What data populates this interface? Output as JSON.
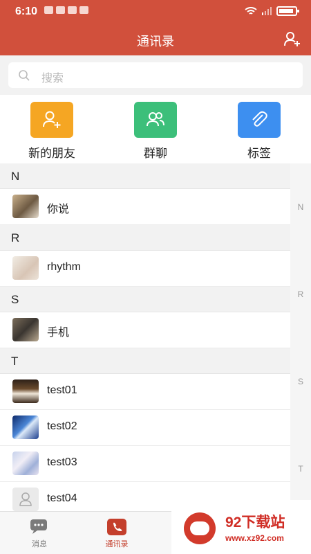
{
  "status_bar": {
    "time": "6:10"
  },
  "header": {
    "title": "通讯录",
    "add_icon": "add-contact-icon"
  },
  "search": {
    "placeholder": "搜索"
  },
  "quick_actions": [
    {
      "label": "新的朋友",
      "icon": "add-user-icon",
      "color": "#f5a623"
    },
    {
      "label": "群聊",
      "icon": "group-icon",
      "color": "#3cbf7a"
    },
    {
      "label": "标签",
      "icon": "paperclip-icon",
      "color": "#3d8ff0"
    }
  ],
  "sections": [
    {
      "letter": "N",
      "contacts": [
        {
          "name": "你说"
        }
      ]
    },
    {
      "letter": "R",
      "contacts": [
        {
          "name": "rhythm"
        }
      ]
    },
    {
      "letter": "S",
      "contacts": [
        {
          "name": "手机"
        }
      ]
    },
    {
      "letter": "T",
      "contacts": [
        {
          "name": "test01"
        },
        {
          "name": "test02"
        },
        {
          "name": "test03"
        },
        {
          "name": "test04"
        }
      ]
    }
  ],
  "index_bar": [
    "N",
    "R",
    "S",
    "T"
  ],
  "tabs": [
    {
      "label": "消息",
      "icon": "message-icon",
      "active": false
    },
    {
      "label": "通讯录",
      "icon": "contacts-icon",
      "active": true
    }
  ],
  "watermark": {
    "title": "92下载站",
    "url": "www.xz92.com"
  },
  "colors": {
    "primary": "#d1503c",
    "background": "#f2f2f2"
  }
}
